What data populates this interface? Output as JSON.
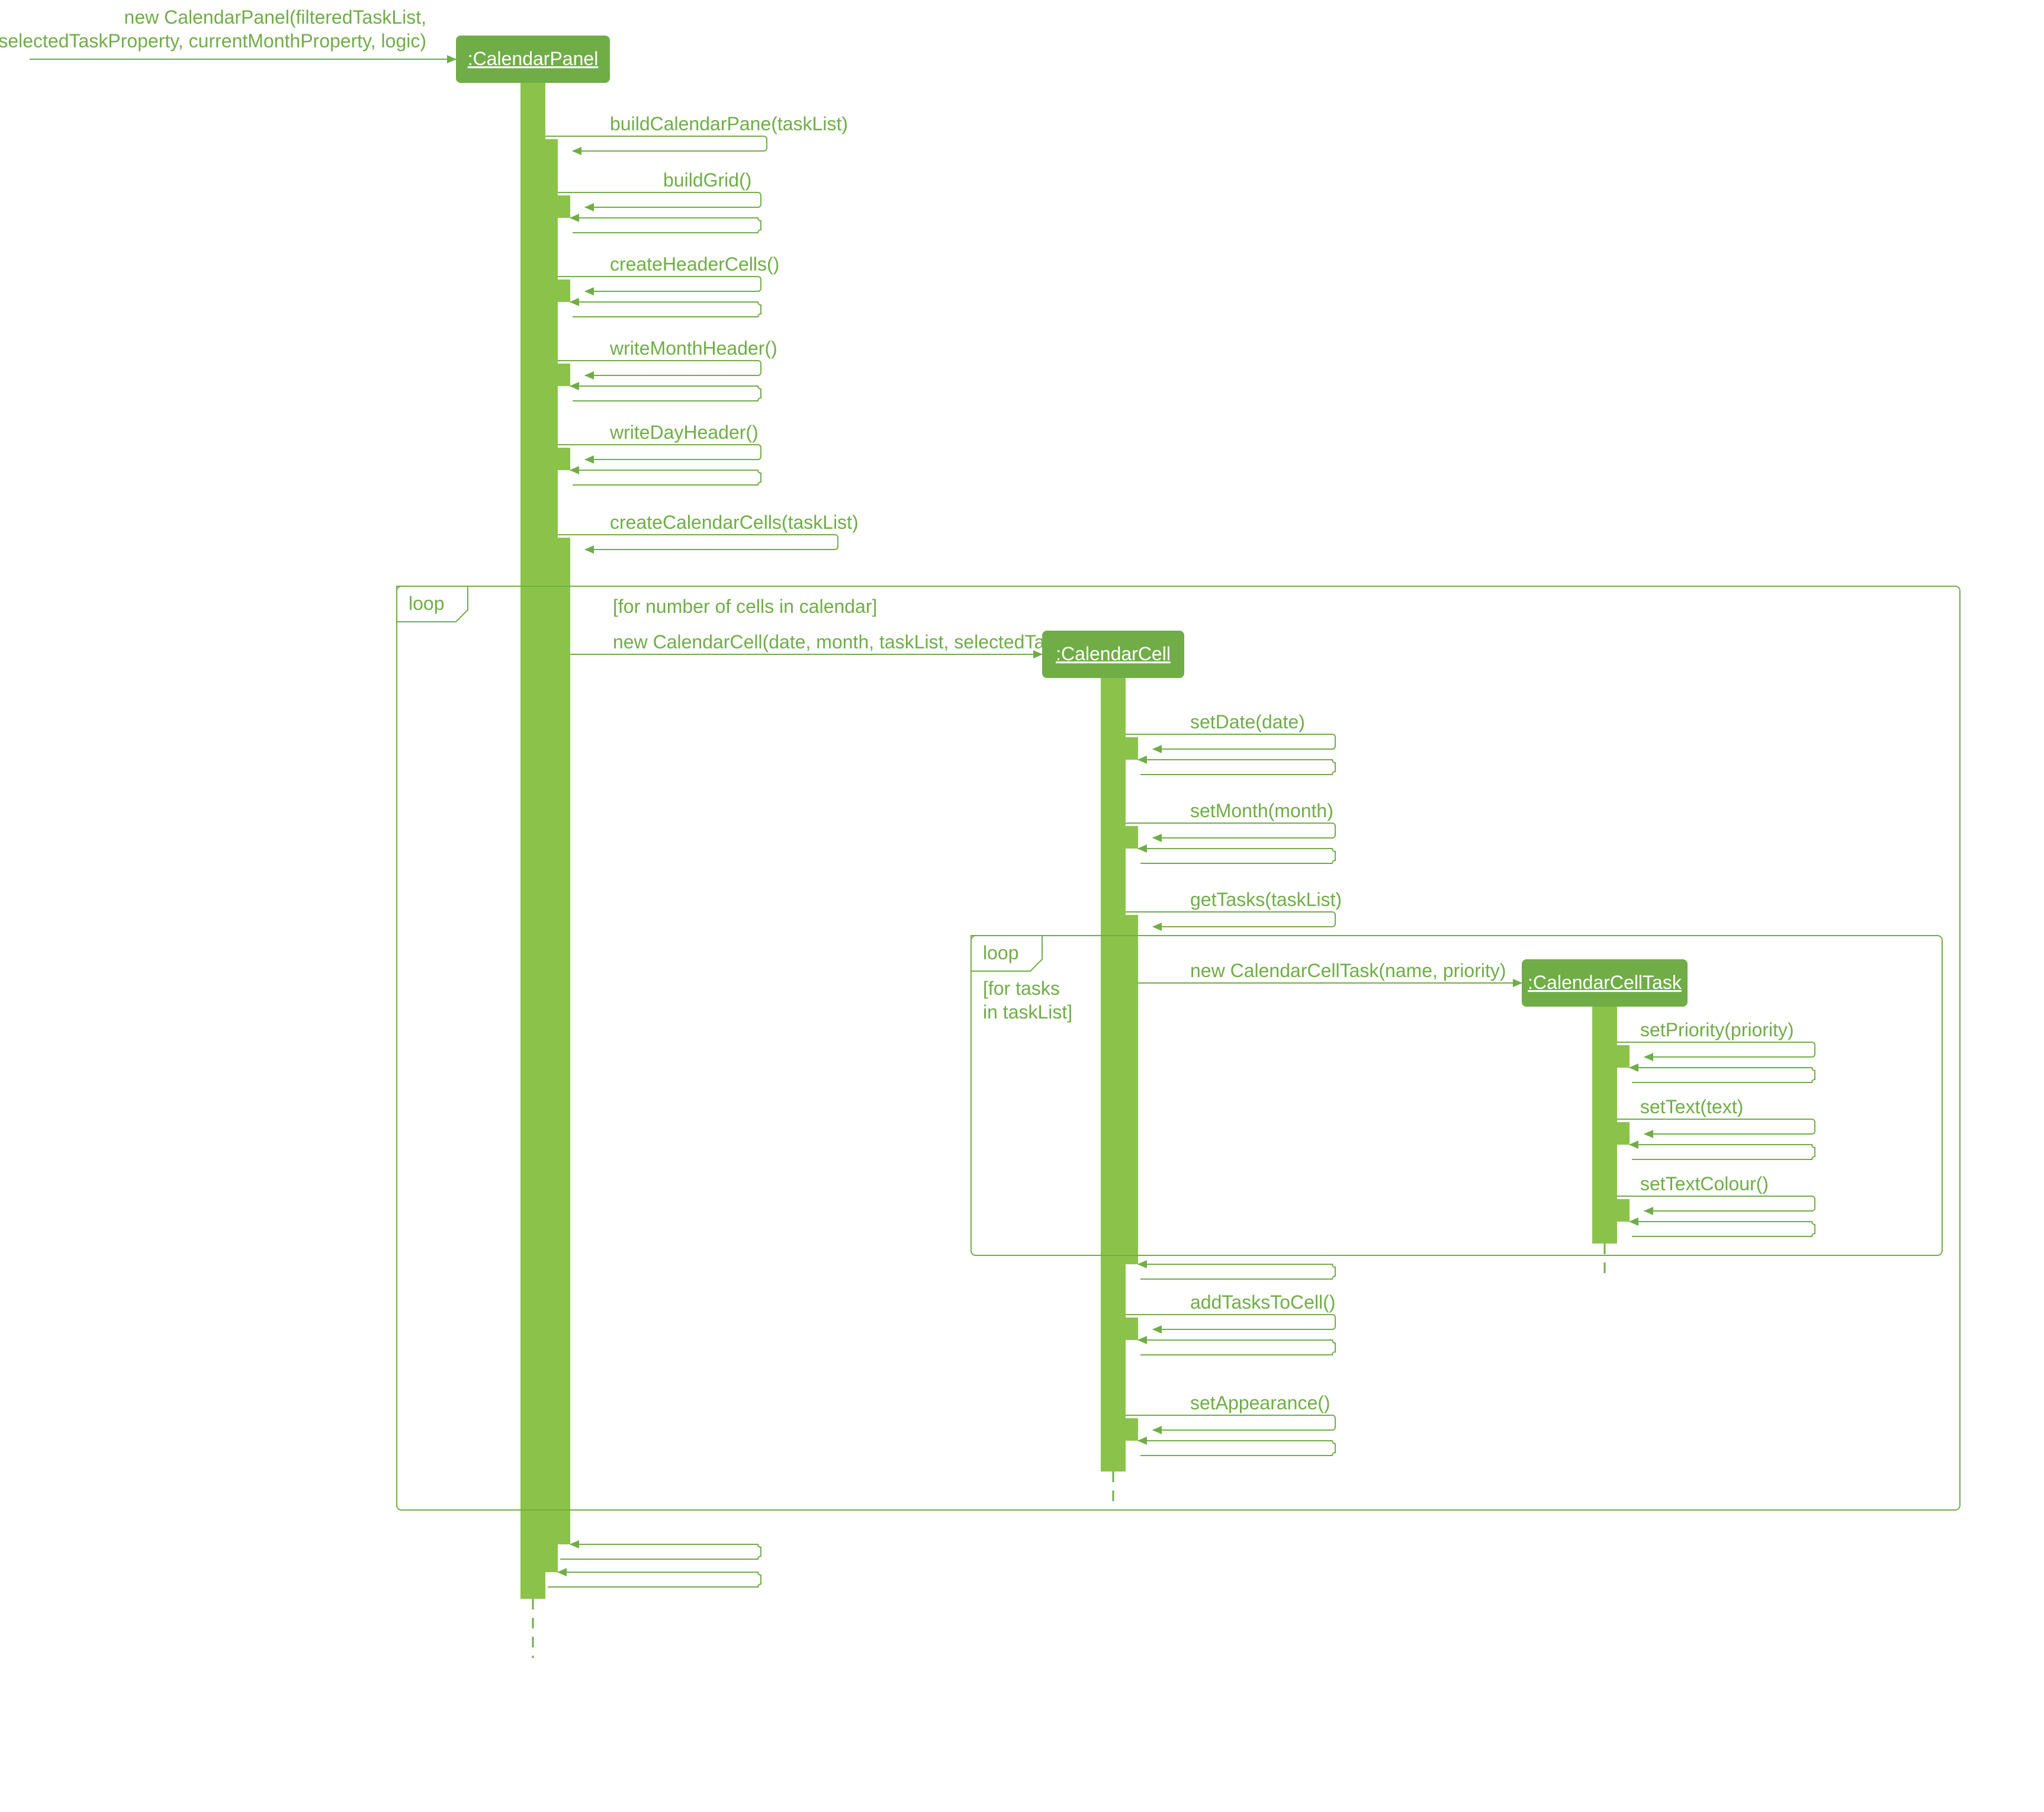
{
  "colors": {
    "dark": "#70AD47",
    "light": "#8BC34A",
    "white": "#ffffff"
  },
  "entry_msg_l1": "new CalendarPanel(filteredTaskList,",
  "entry_msg_l2": "selectedTaskProperty, currentMonthProperty, logic)",
  "participants": {
    "calendarPanel": ":CalendarPanel",
    "calendarCell": ":CalendarCell",
    "calendarCellTask": ":CalendarCellTask"
  },
  "messages": {
    "buildCalendarPane": "buildCalendarPane(taskList)",
    "buildGrid": "buildGrid()",
    "createHeaderCells": "createHeaderCells()",
    "writeMonthHeader": "writeMonthHeader()",
    "writeDayHeader": "writeDayHeader()",
    "createCalendarCells": "createCalendarCells(taskList)",
    "newCalendarCell": "new CalendarCell(date, month, taskList, selectedTask)",
    "setDate": "setDate(date)",
    "setMonth": "setMonth(month)",
    "getTasks": "getTasks(taskList)",
    "newCalendarCellTask": "new CalendarCellTask(name, priority)",
    "setPriority": "setPriority(priority)",
    "setText": "setText(text)",
    "setTextColour": "setTextColour()",
    "addTasksToCell": "addTasksToCell()",
    "setAppearance": "setAppearance()"
  },
  "loops": {
    "label": "loop",
    "outerGuard": "[for number of cells in calendar]",
    "innerGuard_l1": "[for tasks",
    "innerGuard_l2": "in taskList]"
  }
}
